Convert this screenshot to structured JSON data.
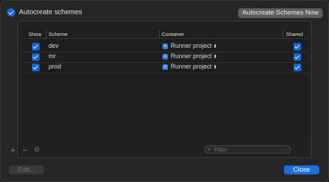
{
  "header": {
    "autocreate_label": "Autocreate schemes",
    "autocreate_checked": true,
    "autocreate_now_label": "Autocreate Schemes Now"
  },
  "table": {
    "columns": {
      "show": "Show",
      "scheme": "Scheme",
      "container": "Container",
      "shared": "Shared"
    },
    "rows": [
      {
        "show": true,
        "scheme": "dev",
        "container": "Runner project",
        "shared": true
      },
      {
        "show": true,
        "scheme": "mr",
        "container": "Runner project",
        "shared": true
      },
      {
        "show": true,
        "scheme": "prod",
        "container": "Runner project",
        "shared": true
      }
    ]
  },
  "toolbar": {
    "add_icon": "plus-icon",
    "remove_icon": "minus-icon",
    "options_icon": "ellipsis-circle-icon"
  },
  "filter": {
    "placeholder": "Filter"
  },
  "footer": {
    "edit_label": "Edit...",
    "close_label": "Close"
  },
  "colors": {
    "accent": "#1f6fe0",
    "background": "#262626"
  }
}
